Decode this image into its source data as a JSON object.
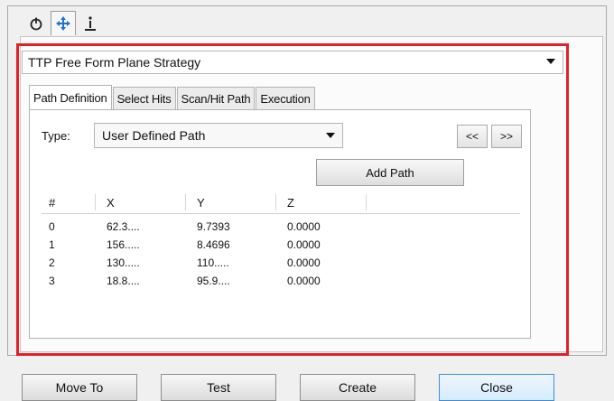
{
  "top_tabs": [
    {
      "icon": "power-icon"
    },
    {
      "icon": "move-arrows-icon"
    },
    {
      "icon": "info-icon"
    }
  ],
  "strategy": {
    "selected": "TTP Free Form Plane Strategy"
  },
  "tabs": [
    {
      "label": "Path Definition"
    },
    {
      "label": "Select Hits"
    },
    {
      "label": "Scan/Hit Path"
    },
    {
      "label": "Execution"
    }
  ],
  "path": {
    "type_label": "Type:",
    "type_value": "User Defined Path",
    "prev_label": "<<",
    "next_label": ">>",
    "add_path_label": "Add Path"
  },
  "grid": {
    "headers": [
      "#",
      "X",
      "Y",
      "Z"
    ],
    "rows": [
      [
        "0",
        "62.3....",
        "9.7393",
        "0.0000"
      ],
      [
        "1",
        "156.....",
        "8.4696",
        "0.0000"
      ],
      [
        "2",
        "130.....",
        "110.....",
        "0.0000"
      ],
      [
        "3",
        "18.8....",
        "95.9....",
        "0.0000"
      ]
    ]
  },
  "buttons": {
    "move_to": "Move To",
    "test": "Test",
    "create": "Create",
    "close": "Close"
  },
  "colors": {
    "highlight": "#e2202a",
    "accent": "#1f73c9"
  }
}
